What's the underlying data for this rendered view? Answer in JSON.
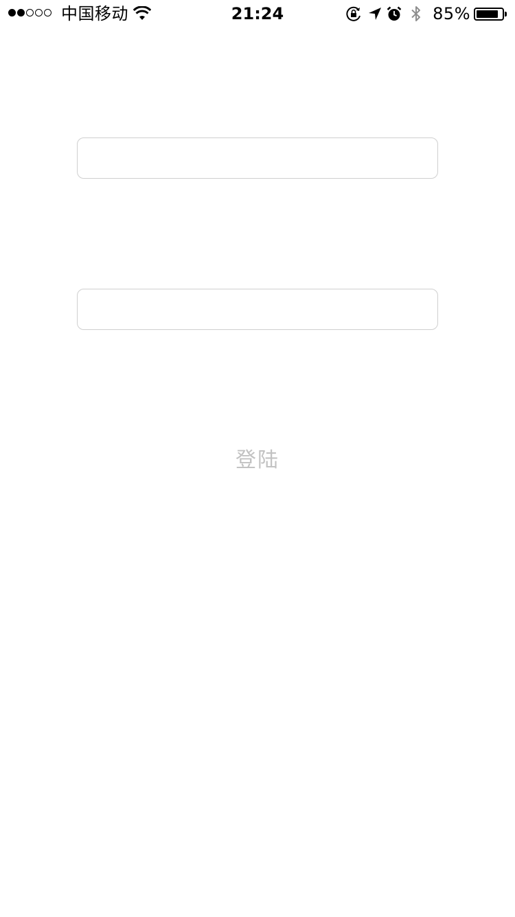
{
  "status_bar": {
    "signal_bars_filled": 2,
    "signal_bars_total": 5,
    "carrier": "中国移动",
    "time": "21:24",
    "battery_percent": "85%",
    "battery_level": 0.85,
    "icons": [
      "wifi-icon",
      "rotation-lock-icon",
      "location-icon",
      "alarm-icon",
      "bluetooth-icon",
      "battery-icon"
    ]
  },
  "login_form": {
    "username": {
      "value": "",
      "placeholder": ""
    },
    "password": {
      "value": "",
      "placeholder": ""
    },
    "login_label": "登陆",
    "login_color": "#c2c2c2"
  }
}
